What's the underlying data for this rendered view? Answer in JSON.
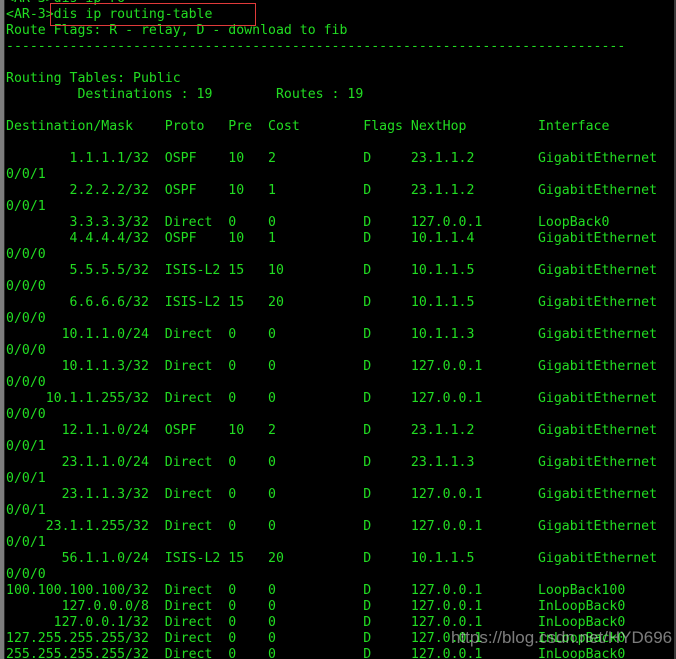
{
  "terminal": {
    "prompt": "<AR-3>",
    "command": "dis ip routing-table",
    "highlight_color": "#e03a3a",
    "text_color": "#22dd22",
    "background_color": "#000000",
    "clipped_top_line": "<AR-3>dis ip ro",
    "route_flags_line": "Route Flags: R - relay, D - download to fib",
    "divider": "------------------------------------------------------------------------------",
    "routing_tables_line": "Routing Tables: Public",
    "summary_line": "         Destinations : 19        Routes : 19",
    "blank_line": "",
    "columns": {
      "destination_mask": "Destination/Mask",
      "proto": "Proto",
      "pre": "Pre",
      "cost": "Cost",
      "flags": "Flags",
      "nexthop": "NextHop",
      "interface": "Interface"
    },
    "header_line": "Destination/Mask    Proto   Pre  Cost        Flags NextHop         Interface",
    "routes": [
      {
        "dest": "1.1.1.1/32",
        "proto": "OSPF",
        "pre": "10",
        "cost": "2",
        "flags": "D",
        "nexthop": "23.1.1.2",
        "interface": "GigabitEthernet",
        "interface_cont": "0/0/1"
      },
      {
        "dest": "2.2.2.2/32",
        "proto": "OSPF",
        "pre": "10",
        "cost": "1",
        "flags": "D",
        "nexthop": "23.1.1.2",
        "interface": "GigabitEthernet",
        "interface_cont": "0/0/1"
      },
      {
        "dest": "3.3.3.3/32",
        "proto": "Direct",
        "pre": "0",
        "cost": "0",
        "flags": "D",
        "nexthop": "127.0.0.1",
        "interface": "LoopBack0",
        "interface_cont": ""
      },
      {
        "dest": "4.4.4.4/32",
        "proto": "OSPF",
        "pre": "10",
        "cost": "1",
        "flags": "D",
        "nexthop": "10.1.1.4",
        "interface": "GigabitEthernet",
        "interface_cont": "0/0/0"
      },
      {
        "dest": "5.5.5.5/32",
        "proto": "ISIS-L2",
        "pre": "15",
        "cost": "10",
        "flags": "D",
        "nexthop": "10.1.1.5",
        "interface": "GigabitEthernet",
        "interface_cont": "0/0/0"
      },
      {
        "dest": "6.6.6.6/32",
        "proto": "ISIS-L2",
        "pre": "15",
        "cost": "20",
        "flags": "D",
        "nexthop": "10.1.1.5",
        "interface": "GigabitEthernet",
        "interface_cont": "0/0/0"
      },
      {
        "dest": "10.1.1.0/24",
        "proto": "Direct",
        "pre": "0",
        "cost": "0",
        "flags": "D",
        "nexthop": "10.1.1.3",
        "interface": "GigabitEthernet",
        "interface_cont": "0/0/0"
      },
      {
        "dest": "10.1.1.3/32",
        "proto": "Direct",
        "pre": "0",
        "cost": "0",
        "flags": "D",
        "nexthop": "127.0.0.1",
        "interface": "GigabitEthernet",
        "interface_cont": "0/0/0"
      },
      {
        "dest": "10.1.1.255/32",
        "proto": "Direct",
        "pre": "0",
        "cost": "0",
        "flags": "D",
        "nexthop": "127.0.0.1",
        "interface": "GigabitEthernet",
        "interface_cont": "0/0/0"
      },
      {
        "dest": "12.1.1.0/24",
        "proto": "OSPF",
        "pre": "10",
        "cost": "2",
        "flags": "D",
        "nexthop": "23.1.1.2",
        "interface": "GigabitEthernet",
        "interface_cont": "0/0/1"
      },
      {
        "dest": "23.1.1.0/24",
        "proto": "Direct",
        "pre": "0",
        "cost": "0",
        "flags": "D",
        "nexthop": "23.1.1.3",
        "interface": "GigabitEthernet",
        "interface_cont": "0/0/1"
      },
      {
        "dest": "23.1.1.3/32",
        "proto": "Direct",
        "pre": "0",
        "cost": "0",
        "flags": "D",
        "nexthop": "127.0.0.1",
        "interface": "GigabitEthernet",
        "interface_cont": "0/0/1"
      },
      {
        "dest": "23.1.1.255/32",
        "proto": "Direct",
        "pre": "0",
        "cost": "0",
        "flags": "D",
        "nexthop": "127.0.0.1",
        "interface": "GigabitEthernet",
        "interface_cont": "0/0/1"
      },
      {
        "dest": "56.1.1.0/24",
        "proto": "ISIS-L2",
        "pre": "15",
        "cost": "20",
        "flags": "D",
        "nexthop": "10.1.1.5",
        "interface": "GigabitEthernet",
        "interface_cont": "0/0/0"
      },
      {
        "dest": "100.100.100.100/32",
        "proto": "Direct",
        "pre": "0",
        "cost": "0",
        "flags": "D",
        "nexthop": "127.0.0.1",
        "interface": "LoopBack100",
        "interface_cont": ""
      },
      {
        "dest": "127.0.0.0/8",
        "proto": "Direct",
        "pre": "0",
        "cost": "0",
        "flags": "D",
        "nexthop": "127.0.0.1",
        "interface": "InLoopBack0",
        "interface_cont": ""
      },
      {
        "dest": "127.0.0.1/32",
        "proto": "Direct",
        "pre": "0",
        "cost": "0",
        "flags": "D",
        "nexthop": "127.0.0.1",
        "interface": "InLoopBack0",
        "interface_cont": ""
      },
      {
        "dest": "127.255.255.255/32",
        "proto": "Direct",
        "pre": "0",
        "cost": "0",
        "flags": "D",
        "nexthop": "127.0.0.1",
        "interface": "InLoopBack0",
        "interface_cont": ""
      },
      {
        "dest": "255.255.255.255/32",
        "proto": "Direct",
        "pre": "0",
        "cost": "0",
        "flags": "D",
        "nexthop": "127.0.0.1",
        "interface": "InLoopBack0",
        "interface_cont": ""
      }
    ]
  },
  "watermark": {
    "text": "https://blog.csdn.net/HYD696"
  }
}
